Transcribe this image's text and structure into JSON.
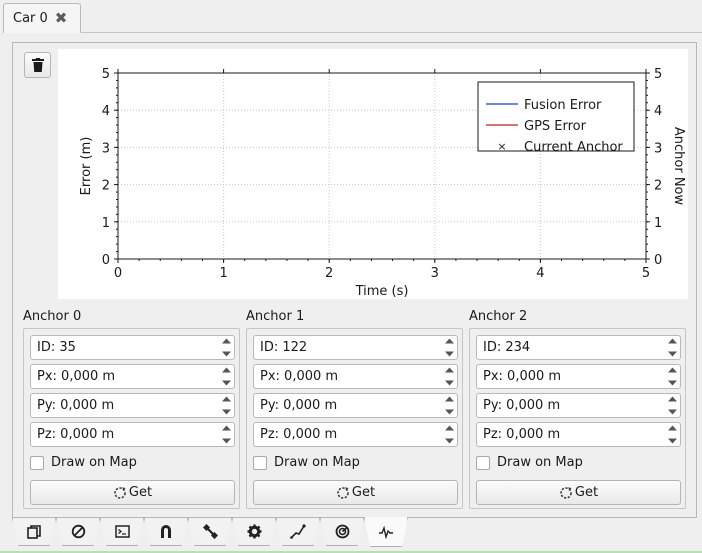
{
  "window": {
    "tab_title": "Car 0"
  },
  "plot": {
    "legend": [
      "Fusion Error",
      "GPS Error",
      "Current Anchor"
    ],
    "colors": {
      "fusion": "#1f3fbf",
      "gps": "#b52020",
      "marker": "#333333"
    }
  },
  "chart_data": {
    "type": "line",
    "xlabel": "Time (s)",
    "ylabel": "Error (m)",
    "y2label": "Anchor Now",
    "xlim": [
      0,
      5
    ],
    "ylim": [
      0,
      5
    ],
    "y2lim": [
      0,
      5
    ],
    "x_ticks": [
      "0",
      "1",
      "2",
      "3",
      "4",
      "5"
    ],
    "y_ticks": [
      "0",
      "1",
      "2",
      "3",
      "4",
      "5"
    ],
    "y2_ticks": [
      "0",
      "1",
      "2",
      "3",
      "4",
      "5"
    ],
    "grid": true,
    "legend_position": "top-right",
    "series": [
      {
        "name": "Fusion Error",
        "x": [],
        "y": []
      },
      {
        "name": "GPS Error",
        "x": [],
        "y": []
      },
      {
        "name": "Current Anchor",
        "x": [],
        "y": []
      }
    ]
  },
  "anchors": [
    {
      "title": "Anchor 0",
      "id": "ID: 35",
      "px": "Px: 0,000 m",
      "py": "Py: 0,000 m",
      "pz": "Pz: 0,000 m",
      "draw_label": "Draw on Map",
      "draw_checked": false,
      "get_label": "Get"
    },
    {
      "title": "Anchor 1",
      "id": "ID: 122",
      "px": "Px: 0,000 m",
      "py": "Py: 0,000 m",
      "pz": "Pz: 0,000 m",
      "draw_label": "Draw on Map",
      "draw_checked": false,
      "get_label": "Get"
    },
    {
      "title": "Anchor 2",
      "id": "ID: 234",
      "px": "Px: 0,000 m",
      "py": "Py: 0,000 m",
      "pz": "Pz: 0,000 m",
      "draw_label": "Draw on Map",
      "draw_checked": false,
      "get_label": "Get"
    }
  ],
  "bottom_tabs": [
    {
      "icon": "copy-icon"
    },
    {
      "icon": "no-sign-icon"
    },
    {
      "icon": "terminal-icon"
    },
    {
      "icon": "magnet-icon"
    },
    {
      "icon": "satellite-icon"
    },
    {
      "icon": "gear-icon"
    },
    {
      "icon": "route-icon"
    },
    {
      "icon": "radar-icon"
    },
    {
      "icon": "pulse-icon",
      "active": true
    }
  ]
}
